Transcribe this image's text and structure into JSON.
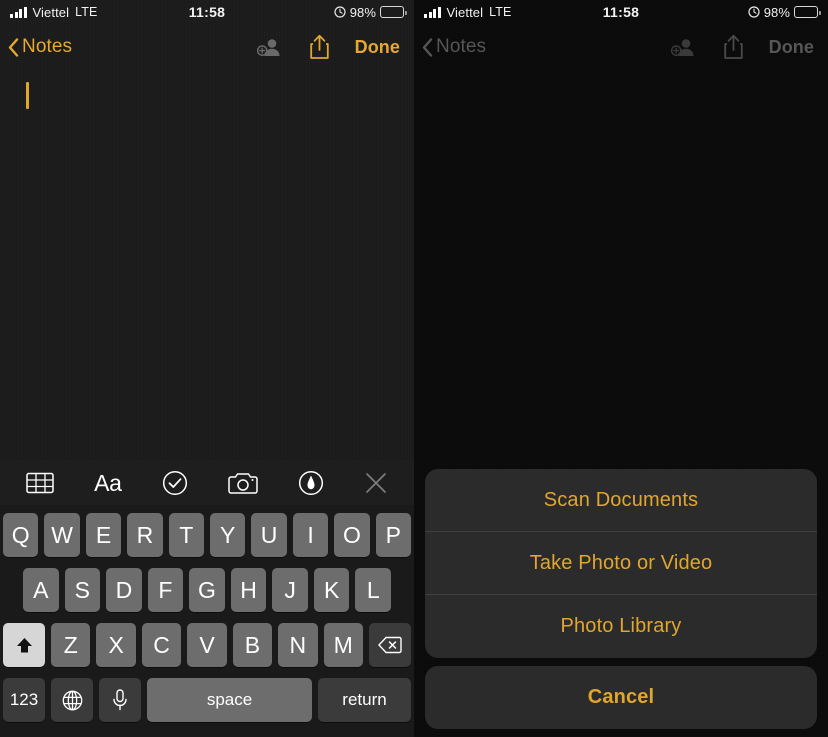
{
  "status_bar": {
    "carrier": "Viettel",
    "network": "LTE",
    "time": "11:58",
    "battery_percent": "98%",
    "signal_bars": 4,
    "alarm_icon": "clock-rotation-icon",
    "battery_icon": "battery-icon"
  },
  "nav_bar": {
    "back_label": "Notes",
    "back_icon": "chevron-left-icon",
    "collaborate_icon": "add-person-icon",
    "share_icon": "share-icon",
    "done_label": "Done"
  },
  "note": {
    "content": "",
    "caret_visible": true
  },
  "format_toolbar": {
    "items": [
      {
        "name": "table-icon",
        "label": "Table"
      },
      {
        "name": "text-format-icon",
        "label": "Aa"
      },
      {
        "name": "checklist-icon",
        "label": "Checklist"
      },
      {
        "name": "camera-icon",
        "label": "Camera"
      },
      {
        "name": "markup-icon",
        "label": "Markup"
      },
      {
        "name": "close-icon",
        "label": "Close"
      }
    ]
  },
  "keyboard": {
    "row1": [
      "Q",
      "W",
      "E",
      "R",
      "T",
      "Y",
      "U",
      "I",
      "O",
      "P"
    ],
    "row2": [
      "A",
      "S",
      "D",
      "F",
      "G",
      "H",
      "J",
      "K",
      "L"
    ],
    "row3": [
      "Z",
      "X",
      "C",
      "V",
      "B",
      "N",
      "M"
    ],
    "shift_icon": "shift-up-arrow-icon",
    "backspace_icon": "backspace-icon",
    "numbers_label": "123",
    "globe_icon": "globe-icon",
    "mic_icon": "microphone-icon",
    "space_label": "space",
    "return_label": "return"
  },
  "action_sheet": {
    "options": [
      "Scan Documents",
      "Take Photo or Video",
      "Photo Library"
    ],
    "cancel_label": "Cancel"
  },
  "colors": {
    "accent_gold": "#e0a62e",
    "note_background": "#1b1b1b",
    "dimmed_background": "#0b0b0b",
    "keyboard_background": "#1a1a1a",
    "key_face": "#6d6d6d",
    "key_dark": "#3b3b3b",
    "sheet_background": "#2b2b2b",
    "disabled_gray": "#565656"
  }
}
